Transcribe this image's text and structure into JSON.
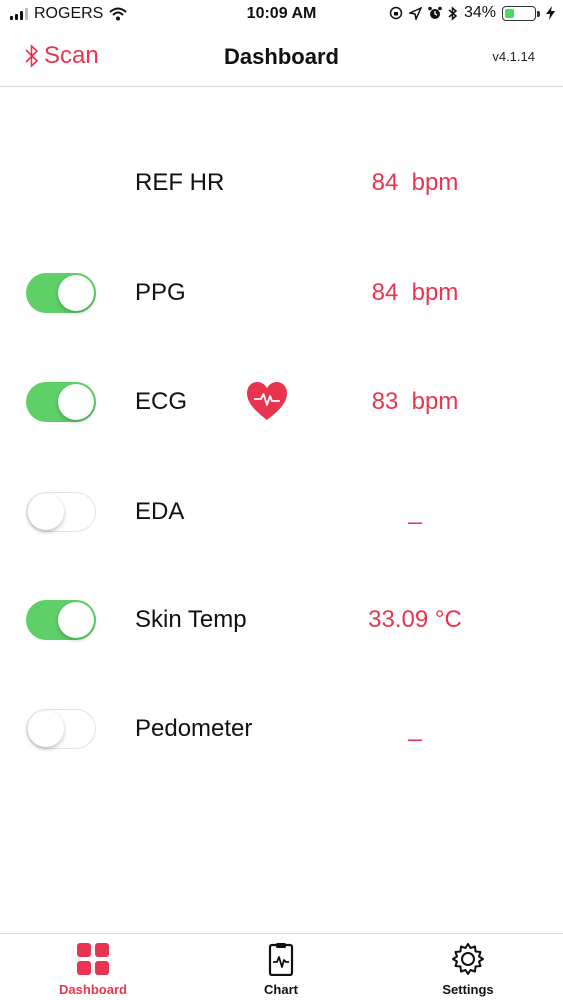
{
  "status_bar": {
    "carrier": "ROGERS",
    "time": "10:09 AM",
    "battery_percent": "34%",
    "battery_level": 0.34,
    "icons": [
      "signal-icon",
      "wifi-icon",
      "orientation-lock-icon",
      "location-icon",
      "alarm-icon",
      "bluetooth-icon",
      "battery-icon",
      "charging-icon"
    ]
  },
  "nav": {
    "scan_label": "Scan",
    "title": "Dashboard",
    "version": "v4.1.14"
  },
  "rows": [
    {
      "label": "REF HR",
      "value": "84  bpm",
      "toggle": null
    },
    {
      "label": "PPG",
      "value": "84  bpm",
      "toggle": true
    },
    {
      "label": "ECG",
      "value": "83  bpm",
      "toggle": true,
      "icon": "heart-pulse-icon"
    },
    {
      "label": "EDA",
      "value": "_",
      "toggle": false
    },
    {
      "label": "Skin Temp",
      "value": "33.09 °C",
      "toggle": true
    },
    {
      "label": "Pedometer",
      "value": "_",
      "toggle": false
    }
  ],
  "tabs": [
    {
      "label": "Dashboard",
      "icon": "grid-icon",
      "active": true
    },
    {
      "label": "Chart",
      "icon": "clipboard-chart-icon",
      "active": false
    },
    {
      "label": "Settings",
      "icon": "gear-icon",
      "active": false
    }
  ],
  "colors": {
    "accent": "#e8344e",
    "toggle_on": "#5fd068",
    "text": "#111111"
  }
}
